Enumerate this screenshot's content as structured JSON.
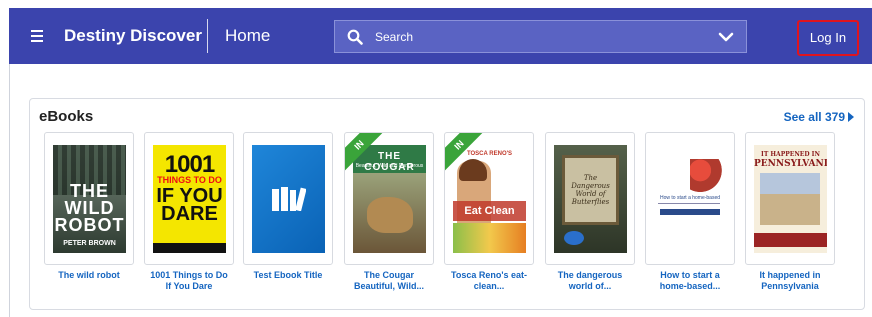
{
  "header": {
    "app_title": "Destiny Discover",
    "home_label": "Home",
    "search_placeholder": "Search",
    "login_label": "Log In"
  },
  "ebooks": {
    "section_title": "eBooks",
    "see_all_label": "See all 379",
    "books": [
      {
        "title": "The wild robot",
        "cover_text": [
          "THE",
          "WILD",
          "ROBOT",
          "PETER BROWN"
        ]
      },
      {
        "title": "1001 Things to Do If You Dare",
        "cover_text": [
          "1001",
          "THINGS TO DO",
          "IF YOU DARE"
        ]
      },
      {
        "title": "Test Ebook Title"
      },
      {
        "title": "The Cougar Beautiful, Wild...",
        "badge": "IN",
        "cover_text": [
          "THE COUGAR",
          "Beautiful, Wild and Dangerous"
        ]
      },
      {
        "title": "Tosca Reno's eat-clean...",
        "badge": "IN",
        "cover_text": [
          "TOSCA RENO'S",
          "Eat Clean"
        ]
      },
      {
        "title": "The dangerous world of...",
        "cover_text": [
          "The Dangerous World of Butterflies"
        ]
      },
      {
        "title": "How to start a home-based...",
        "cover_text": [
          "How to start a home-based"
        ]
      },
      {
        "title": "It happened in Pennsylvania",
        "cover_text": [
          "IT HAPPENED IN",
          "PENNSYLVANIA"
        ]
      }
    ]
  },
  "colors": {
    "header_bg": "#3b44ad",
    "search_bg": "#5a63c3",
    "link_blue": "#1565c0",
    "badge_green": "#3aa43a",
    "login_border": "#e0141e"
  }
}
